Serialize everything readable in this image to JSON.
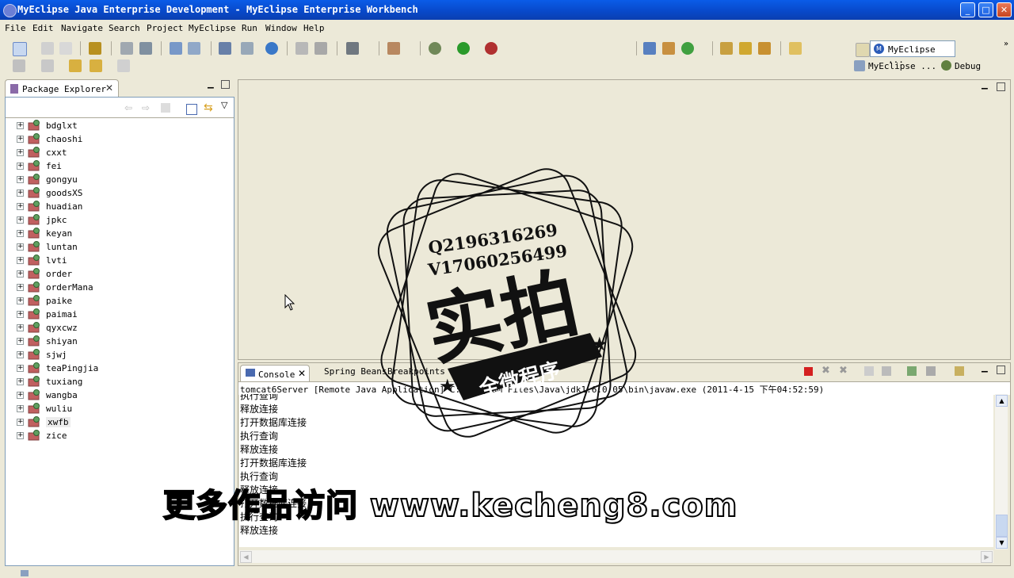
{
  "window": {
    "title": "MyEclipse Java Enterprise Development - MyEclipse Enterprise Workbench",
    "minimize": "_",
    "maximize": "□",
    "close": "✕"
  },
  "menu": [
    "File",
    "Edit",
    "Navigate",
    "Search",
    "Project",
    "MyEclipse",
    "Run",
    "Window",
    "Help"
  ],
  "perspectives": {
    "current": "MyEclipse ...",
    "other1": "MyEclipse ...",
    "other2": "Debug"
  },
  "package_explorer": {
    "tab_label": "Package Explorer",
    "projects": [
      "bdglxt",
      "chaoshi",
      "cxxt",
      "fei",
      "gongyu",
      "goodsXS",
      "huadian",
      "jpkc",
      "keyan",
      "luntan",
      "lvti",
      "order",
      "orderMana",
      "paike",
      "paimai",
      "qyxcwz",
      "shiyan",
      "sjwj",
      "teaPingjia",
      "tuxiang",
      "wangba",
      "wuliu",
      "xwfb",
      "zice"
    ],
    "selected": "xwfb"
  },
  "console": {
    "tabs": [
      "Console",
      "Spring Beans",
      "Breakpoints"
    ],
    "active_tab": "Console",
    "header": "tomcat6Server [Remote Java Application] C:\\Program Files\\Java\\jdk1.6.0_05\\bin\\javaw.exe (2011-4-15 下午04:52:59)",
    "lines": [
      "执行查询",
      "释放连接",
      "打开数据库连接",
      "执行查询",
      "释放连接",
      "打开数据库连接",
      "执行查询",
      "释放连接",
      "打开数据库连接",
      "执行查询",
      "释放连接"
    ]
  },
  "watermark": {
    "qq": "Q2196316269",
    "vx": "V17060256499",
    "big": "实拍",
    "banner": "全微程序",
    "footer": "更多作品访问 www.kecheng8.com"
  },
  "colors": {
    "titlebar": "#0a5ce8",
    "chrome": "#ece9d8",
    "border": "#7f9db9",
    "stop_button": "#d42020"
  }
}
